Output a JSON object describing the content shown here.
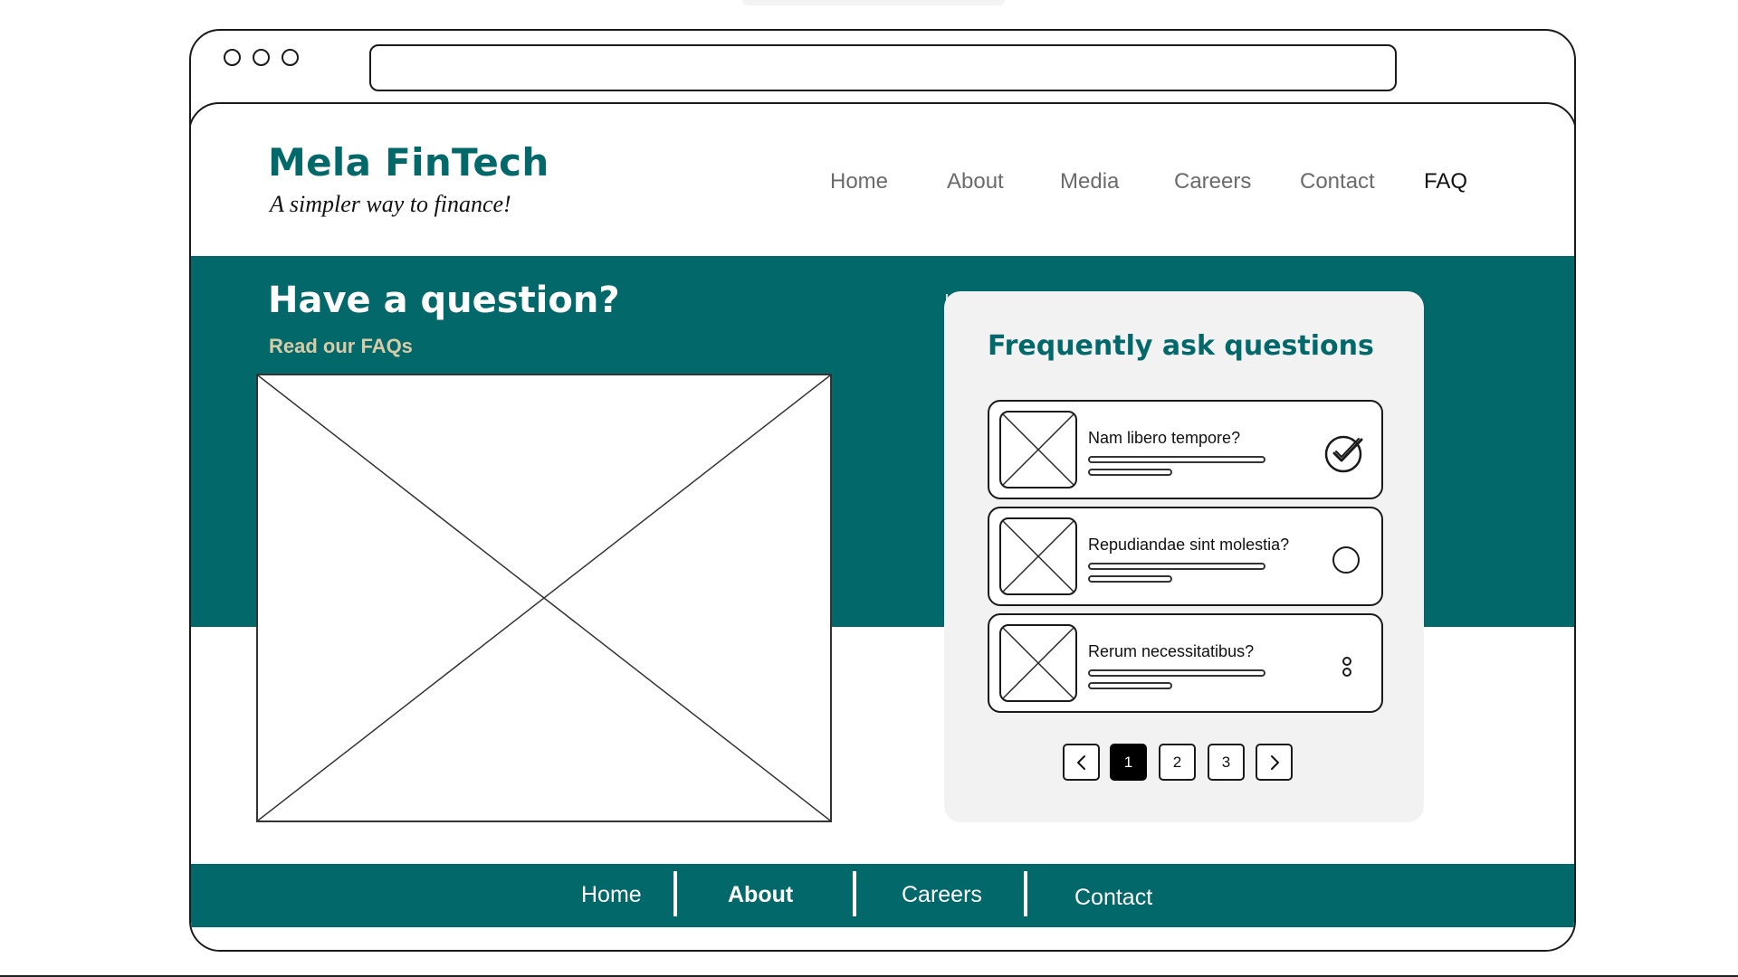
{
  "header": {
    "brand_name": "Mela FinTech",
    "tagline": "A simpler way to finance!",
    "nav": [
      {
        "label": "Home"
      },
      {
        "label": "About"
      },
      {
        "label": "Media"
      },
      {
        "label": "Careers"
      },
      {
        "label": "Contact"
      },
      {
        "label": "FAQ",
        "active": true
      }
    ]
  },
  "hero": {
    "title": "Have a question?",
    "subtitle": "Read our FAQs"
  },
  "faq": {
    "title": "Frequently ask questions",
    "items": [
      {
        "question": "Nam libero tempore?",
        "status_icon": "check-circle-icon"
      },
      {
        "question": "Repudiandae sint molestia?",
        "status_icon": "empty-circle-icon"
      },
      {
        "question": "Rerum necessitatibus?",
        "status_icon": "more-vertical-icon"
      }
    ],
    "pagination": {
      "prev_icon": "chevron-left-icon",
      "pages": [
        "1",
        "2",
        "3"
      ],
      "current_page": "1",
      "next_icon": "chevron-right-icon"
    }
  },
  "footer": {
    "links": [
      {
        "label": "Home"
      },
      {
        "label": "About",
        "bold": true
      },
      {
        "label": "Careers"
      },
      {
        "label": "Contact"
      }
    ]
  },
  "colors": {
    "brand_teal": "#02686a",
    "accent_beige": "#d8cba8",
    "card_bg": "#f2f2f2"
  }
}
